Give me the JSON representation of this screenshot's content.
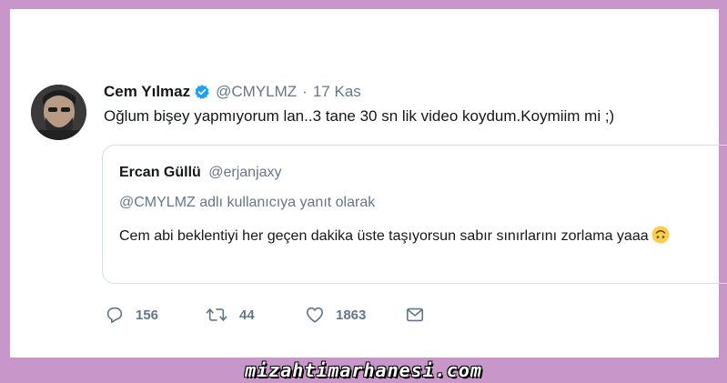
{
  "tweet": {
    "author_name": "Cem Yılmaz",
    "author_handle": "@CMYLMZ",
    "separator": "·",
    "date": "17 Kas",
    "text": "Oğlum bişey yapmıyorum lan..3 tane 30 sn lik video koydum.Koymiim mi ;)"
  },
  "quote": {
    "author_name": "Ercan Güllü",
    "author_handle": "@erjanjaxy",
    "reply_context": "@CMYLMZ adlı kullanıcıya yanıt olarak",
    "text": "Cem abi beklentiyi her geçen dakika üste taşıyorsun sabır sınırlarını zorlama yaaa",
    "emoji_icon": "upside-down-face-icon"
  },
  "actions": {
    "reply_count": "156",
    "retweet_count": "44",
    "like_count": "1863",
    "icons": [
      "reply-icon",
      "retweet-icon",
      "like-icon",
      "direct-message-icon"
    ]
  },
  "footer": {
    "watermark": "mizahtimarhanesi.com"
  },
  "colors": {
    "frame": "#c996c9",
    "verified": "#1da1f2",
    "secondary_text": "#657786",
    "primary_text": "#14171a"
  }
}
